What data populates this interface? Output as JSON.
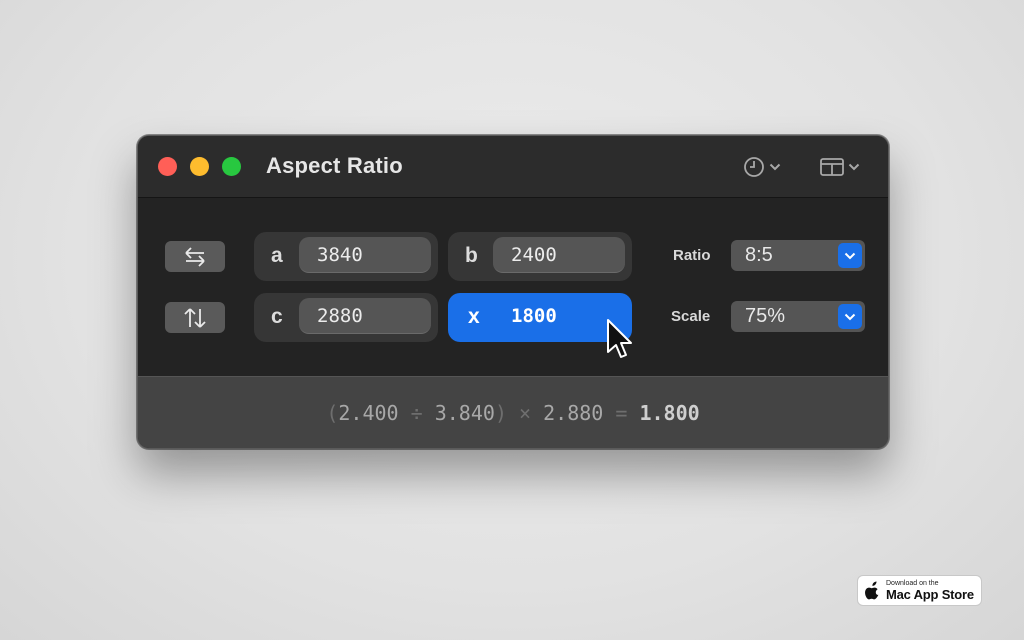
{
  "window": {
    "title": "Aspect Ratio",
    "toolbar": {
      "history_icon": "clock-icon",
      "layout_icon": "sidebar-layout-icon"
    }
  },
  "buttons": {
    "swap_horizontal_icon": "swap-horizontal-arrows-icon",
    "swap_vertical_icon": "swap-vertical-arrows-icon"
  },
  "fields": {
    "a": {
      "label": "a",
      "value": "3840"
    },
    "b": {
      "label": "b",
      "value": "2400"
    },
    "c": {
      "label": "c",
      "value": "2880"
    },
    "x": {
      "label": "x",
      "value": "1800"
    }
  },
  "ratio": {
    "label": "Ratio",
    "value": "8:5"
  },
  "scale": {
    "label": "Scale",
    "value": "75%"
  },
  "formula": {
    "open": "(",
    "b": "2.400",
    "div": " ÷ ",
    "a": "3.840",
    "close": ")",
    "mul": " × ",
    "c": "2.880",
    "eq": " = ",
    "result": "1.800"
  },
  "badge": {
    "line1": "Download on the",
    "line2": "Mac App Store"
  },
  "colors": {
    "accent": "#1a6fe8",
    "close": "#ff5f57",
    "minimize": "#febc2e",
    "zoom": "#28c840"
  }
}
